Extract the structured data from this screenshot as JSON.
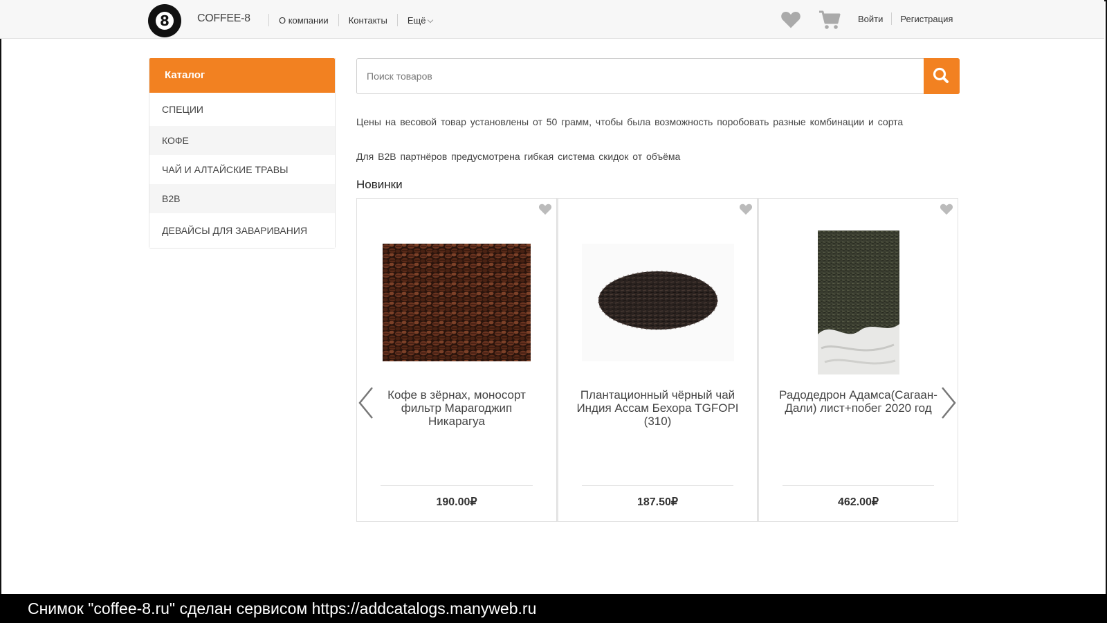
{
  "header": {
    "logo_text": "8",
    "brand": "COFFEE-8",
    "nav": [
      {
        "label": "О компании"
      },
      {
        "label": "Контакты"
      },
      {
        "label": "Ещё"
      }
    ],
    "icons": {
      "favorites": "heart-icon",
      "cart": "cart-icon"
    },
    "login": "Войти",
    "register": "Регистрация"
  },
  "sidebar": {
    "title": "Каталог",
    "items": [
      {
        "label": "СПЕЦИИ"
      },
      {
        "label": "КОФЕ"
      },
      {
        "label": "ЧАЙ И АЛТАЙСКИЕ ТРАВЫ"
      },
      {
        "label": "B2B"
      },
      {
        "label": "ДЕВАЙСЫ ДЛЯ ЗАВАРИВАНИЯ"
      }
    ]
  },
  "search": {
    "placeholder": "Поиск товаров",
    "value": "",
    "icon": "search-icon"
  },
  "info": {
    "line1": "Цены на  весовой  товар  установлены от 50 грамм,  чтобы была возможность  поробовать разные комбинации  и  сорта",
    "line2": "Для B2B партнёров  предусмотрена  гибкая  система скидок от объёма"
  },
  "new_items": {
    "title": "Новинки",
    "products": [
      {
        "name": "Кофе в зёрнах, моносорт фильтр Марагоджип Никарагуа",
        "price": "190.00₽",
        "image": "coffee-beans"
      },
      {
        "name": "Плантационный чёрный чай Индия Ассам Бехора TGFOPI (310)",
        "price": "187.50₽",
        "image": "black-tea-pile"
      },
      {
        "name": "Радодедрон Адамса(Сагаан-Дали) лист+побег 2020 год",
        "price": "462.00₽",
        "image": "herb-sack"
      }
    ]
  },
  "colors": {
    "accent": "#f28121",
    "icon_gray": "#aaaaaa"
  },
  "caption": "Снимок \"coffee-8.ru\" сделан сервисом https://addcatalogs.manyweb.ru"
}
